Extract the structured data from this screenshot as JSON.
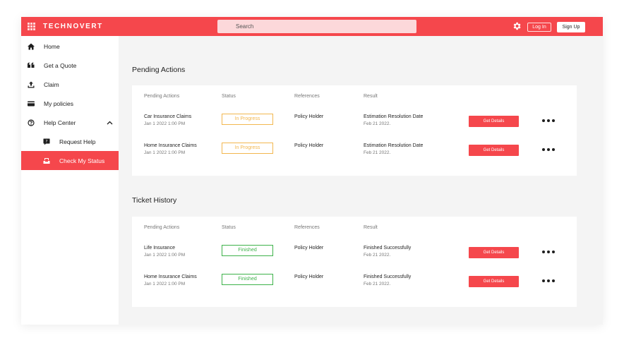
{
  "header": {
    "brand": "TECHNOVERT",
    "search_placeholder": "Search",
    "login_label": "Log In",
    "signup_label": "Sign Up",
    "accent_color": "#f5474c"
  },
  "sidebar": {
    "items": [
      {
        "label": "Home",
        "icon": "home-icon"
      },
      {
        "label": "Get a Quote",
        "icon": "quote-icon"
      },
      {
        "label": "Claim",
        "icon": "upload-icon"
      },
      {
        "label": "My policies",
        "icon": "card-icon"
      },
      {
        "label": "Help Center",
        "icon": "help-center-icon",
        "expanded": true
      },
      {
        "label": "Request Help",
        "icon": "chat-help-icon"
      },
      {
        "label": "Check My Status",
        "icon": "status-icon",
        "active": true
      }
    ]
  },
  "pending": {
    "title": "Pending Actions",
    "headers": [
      "Pending Actions",
      "Status",
      "References",
      "Result"
    ],
    "rows": [
      {
        "name": "Car Insurance Claims",
        "date": "Jan 1 2022 1:00 PM",
        "status": "In Progress",
        "reference": "Policy Holder",
        "result": "Estimation Resolution Date",
        "result_date": "Feb 21 2022.",
        "action": "Get Details"
      },
      {
        "name": "Home Insurance Claims",
        "date": "Jan 1 2022 1:00 PM",
        "status": "In Progress",
        "reference": "Policy Holder",
        "result": "Estimation Resolution Date",
        "result_date": "Feb 21 2022.",
        "action": "Get Details"
      }
    ]
  },
  "history": {
    "title": "Ticket History",
    "headers": [
      "Pending Actions",
      "Status",
      "References",
      "Result"
    ],
    "rows": [
      {
        "name": "Life Insurance",
        "date": "Jan 1 2022 1:00 PM",
        "status": "Finished",
        "reference": "Policy Holder",
        "result": "Finished Successfully",
        "result_date": "Feb 21 2022.",
        "action": "Get Details"
      },
      {
        "name": "Home Insurance Claims",
        "date": "Jan 1 2022 1:00 PM",
        "status": "Finished",
        "reference": "Policy Holder",
        "result": "Finished Successfully",
        "result_date": "Feb 21 2022.",
        "action": "Get Details"
      }
    ]
  },
  "status_colors": {
    "in_progress": "#f2b74f",
    "finished": "#3db24a"
  }
}
